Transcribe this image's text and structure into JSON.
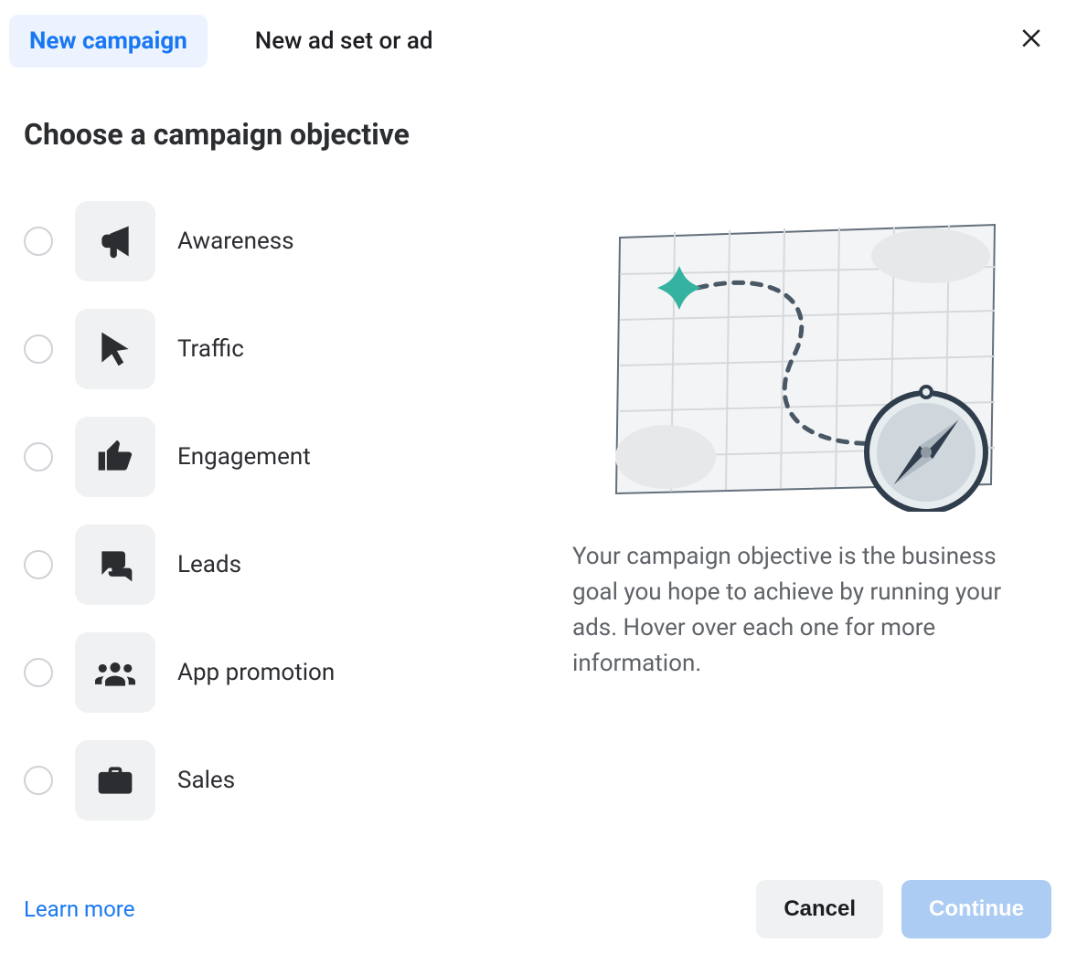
{
  "tabs": {
    "new_campaign": "New campaign",
    "new_adset": "New ad set or ad",
    "active": "new_campaign"
  },
  "title": "Choose a campaign objective",
  "objectives": [
    {
      "id": "awareness",
      "label": "Awareness",
      "icon": "megaphone-icon"
    },
    {
      "id": "traffic",
      "label": "Traffic",
      "icon": "cursor-icon"
    },
    {
      "id": "engagement",
      "label": "Engagement",
      "icon": "thumbs-up-icon"
    },
    {
      "id": "leads",
      "label": "Leads",
      "icon": "chat-bubbles-icon"
    },
    {
      "id": "app_promotion",
      "label": "App promotion",
      "icon": "group-icon"
    },
    {
      "id": "sales",
      "label": "Sales",
      "icon": "briefcase-icon"
    }
  ],
  "info": {
    "description": "Your campaign objective is the business goal you hope to achieve by running your ads. Hover over each one for more information."
  },
  "footer": {
    "learn_more": "Learn more",
    "cancel": "Cancel",
    "continue": "Continue"
  }
}
